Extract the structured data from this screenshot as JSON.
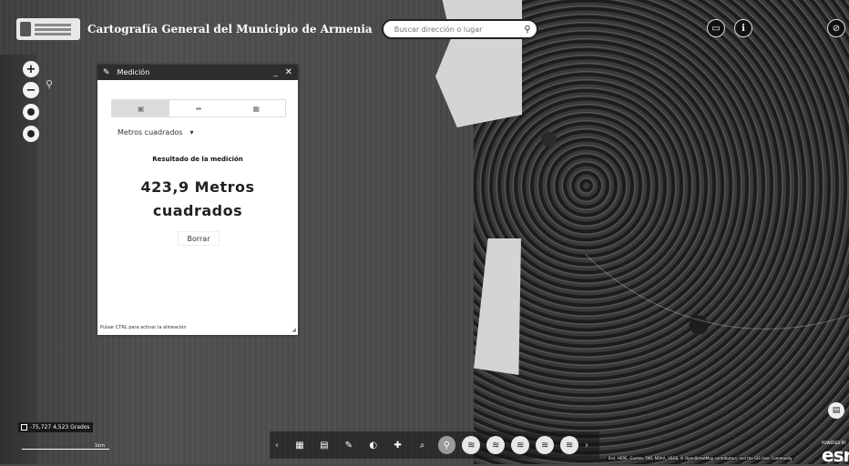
{
  "header": {
    "title": "Cartografía General del Municipio de Armenia",
    "search_placeholder": "Buscar dirección o lugar",
    "search_icon": "search-icon"
  },
  "top_right_buttons": [
    {
      "icon": "printer-icon"
    },
    {
      "icon": "info-icon"
    },
    {
      "icon": "visibility-off-icon"
    }
  ],
  "map_controls": {
    "zoom_in": "+",
    "zoom_out": "−"
  },
  "measure_panel": {
    "title": "Medición",
    "minimize": "_",
    "close": "✕",
    "tools": [
      {
        "icon": "area-icon",
        "active": true
      },
      {
        "icon": "distance-icon",
        "active": false
      },
      {
        "icon": "location-icon",
        "active": false
      }
    ],
    "unit": "Metros cuadrados",
    "unit_caret": "▾",
    "result_label": "Resultado de la medición",
    "result_value": "423,9 Metros cuadrados",
    "clear_label": "Borrar",
    "hint": "Pulsar CTRL para activar la alineación"
  },
  "status": {
    "coordinates": "-75,727 4,523 Grados",
    "scale_label": "1km"
  },
  "toolbar": {
    "prev": "‹",
    "next": "›",
    "items": [
      {
        "icon": "grid-icon",
        "glyph": "▦",
        "style": "plain"
      },
      {
        "icon": "layers-icon",
        "glyph": "▤",
        "style": "plain"
      },
      {
        "icon": "pencil-icon",
        "glyph": "✎",
        "style": "plain"
      },
      {
        "icon": "swipe-icon",
        "glyph": "◐",
        "style": "plain"
      },
      {
        "icon": "share-icon",
        "glyph": "✚",
        "style": "plain"
      },
      {
        "icon": "query-icon",
        "glyph": "⌕",
        "style": "plain"
      },
      {
        "icon": "search-icon",
        "glyph": "⚲",
        "style": "active"
      },
      {
        "icon": "stack-icon",
        "glyph": "≋",
        "style": "round"
      },
      {
        "icon": "stack-icon-2",
        "glyph": "≋",
        "style": "round"
      },
      {
        "icon": "stack-icon-3",
        "glyph": "≋",
        "style": "round"
      },
      {
        "icon": "stack-icon-4",
        "glyph": "≋",
        "style": "round"
      },
      {
        "icon": "stack-icon-5",
        "glyph": "≋",
        "style": "round"
      }
    ]
  },
  "attribution": "Esri, HERE, Garmin, FAO, NOAA, USGS, © OpenStreetMap contributors, and the GIS User Community",
  "esri_logo": "esri",
  "esri_small": "POWERED BY"
}
